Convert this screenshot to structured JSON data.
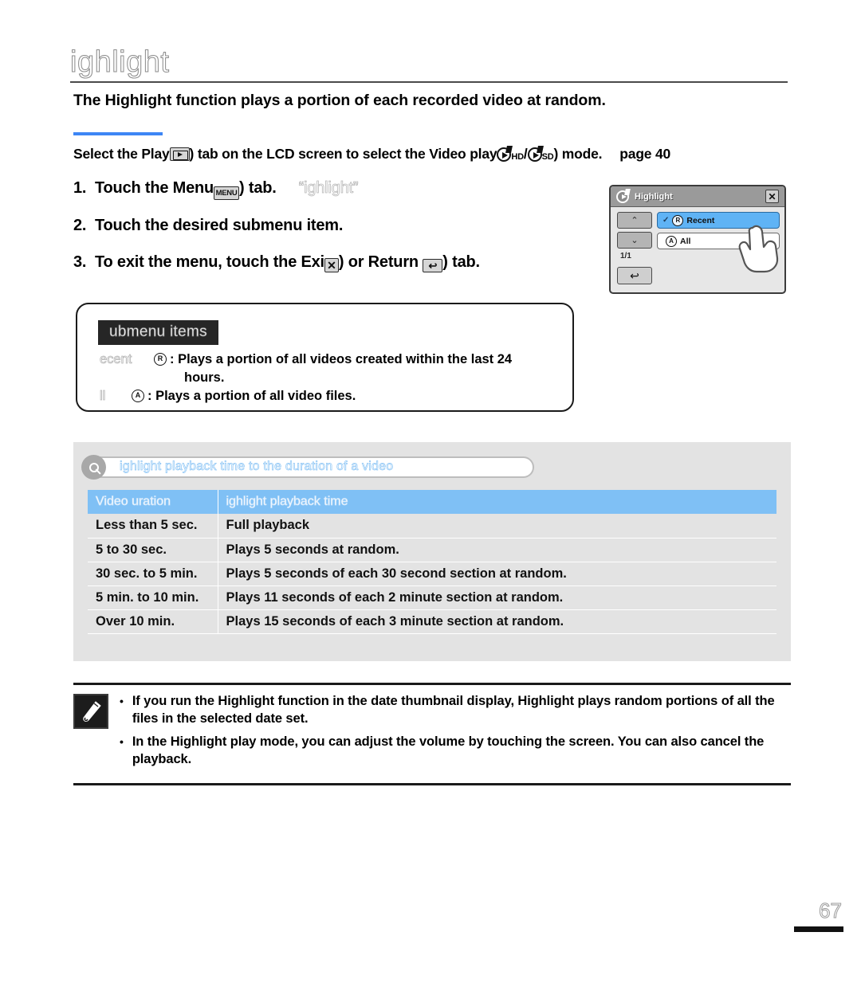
{
  "document": {
    "title": "ighlight",
    "intro": "The Highlight function plays a portion of each recorded video at random.",
    "page_number": "67"
  },
  "precondition": {
    "text_before_icon": "Select the Play",
    "play_tab_icon": "play-tab-icon",
    "text_after_icon": ") tab on the LCD screen to select the Video play",
    "mode_hd_icon": "video-play-hd-icon",
    "mode_hd_label": "HD",
    "mode_separator": "/",
    "mode_sd_icon": "video-play-sd-icon",
    "mode_sd_label": "SD",
    "text_tail": ") mode.",
    "page_ref": "page 40"
  },
  "steps": [
    {
      "number": "1.",
      "text_before": "Touch the Menu",
      "icon": "menu-button-icon",
      "icon_label": "MENU",
      "text_after": ") tab.",
      "quoted": "“ighlight”"
    },
    {
      "number": "2.",
      "text_before": "Touch the desired submenu item.",
      "icon": "",
      "icon_label": "",
      "text_after": "",
      "quoted": ""
    },
    {
      "number": "3.",
      "text_before": "To exit the menu, touch the Exi",
      "icon": "exit-x-icon",
      "icon_label": "✕",
      "text_after": ") or Return",
      "return_icon": "return-arrow-icon",
      "return_icon_label": "↩",
      "text_tail": ") tab.",
      "quoted": ""
    }
  ],
  "lcd": {
    "title": "Highlight",
    "title_icon": "video-play-disc-icon",
    "close_icon": "✕",
    "nav_up_icon": "⌃",
    "nav_down_icon": "⌄",
    "page_indicator": "1/1",
    "return_icon": "↩",
    "items": [
      {
        "label": "Recent",
        "badge": "R",
        "selected": true,
        "check": "✓"
      },
      {
        "label": "All",
        "badge": "A",
        "selected": false,
        "check": ""
      }
    ],
    "hand_cursor": "hand-pointer-icon"
  },
  "submenu_box": {
    "heading": "ubmenu items",
    "items": [
      {
        "term": "ecent",
        "badge": "R",
        "description": ": Plays a portion of all videos created within the last 24",
        "continuation": "hours."
      },
      {
        "term": "ll",
        "badge": "A",
        "description": ": Plays a portion of all video files.",
        "continuation": ""
      }
    ]
  },
  "info_panel": {
    "search_icon": "search-icon",
    "search_text": "ighlight playback time to the duration of a video"
  },
  "chart_data": {
    "type": "table",
    "title": "ighlight playback time to the duration of a video",
    "columns": [
      "Video uration",
      "ighlight playback time"
    ],
    "rows": [
      [
        "Less than 5 sec.",
        "Full playback"
      ],
      [
        "5 to 30 sec.",
        "Plays 5 seconds at random."
      ],
      [
        "30 sec. to 5 min.",
        "Plays 5 seconds of each 30 second section at random."
      ],
      [
        "5 min. to 10 min.",
        "Plays 11 seconds of each 2 minute section at random."
      ],
      [
        "Over 10 min.",
        "Plays 15 seconds of each 3 minute section at random."
      ]
    ]
  },
  "notes": {
    "icon": "note-pencil-icon",
    "items": [
      "If you run the Highlight function in the date thumbnail display, Highlight plays random portions of all the files in the selected date set.",
      "In the Highlight play mode, you can adjust the volume by touching the screen. You can also cancel the playback."
    ],
    "bullet": "•"
  },
  "colors": {
    "accent_blue": "#3d86f5",
    "table_header_blue": "#7fc0f5",
    "lcd_selected_blue": "#5fb3f5",
    "panel_gray": "#e3e3e3"
  }
}
